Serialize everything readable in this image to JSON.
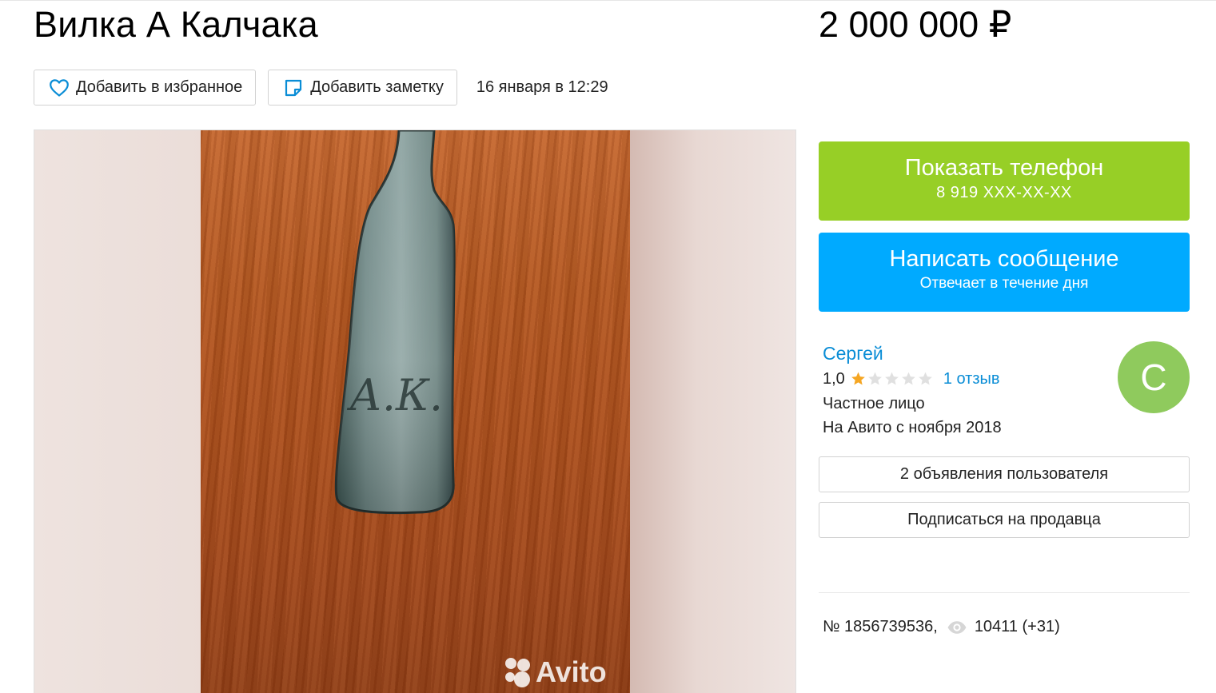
{
  "listing": {
    "title": "Вилка А Калчака",
    "price": "2 000 000 ₽",
    "date": "16 января в 12:29",
    "number": "№ 1856739536,",
    "views": "10411 (+31)"
  },
  "actions": {
    "favorite_label": "Добавить в избранное",
    "note_label": "Добавить заметку"
  },
  "contact": {
    "phone_button_label": "Показать телефон",
    "phone_masked": "8 919 XXX-XX-XX",
    "message_button_label": "Написать сообщение",
    "message_subtitle": "Отвечает в течение дня"
  },
  "seller": {
    "name": "Сергей",
    "rating": "1,0",
    "rating_value": 1,
    "rating_max": 5,
    "reviews": "1 отзыв",
    "type": "Частное лицо",
    "since": "На Авито с ноября 2018",
    "avatar_letter": "С",
    "listings_button": "2 объявления пользователя",
    "subscribe_button": "Подписаться на продавца"
  },
  "gallery": {
    "engraving": "А.К.",
    "watermark": "Avito"
  },
  "colors": {
    "phone_button": "#97cf26",
    "message_button": "#00aaff",
    "link": "#0a8dd6",
    "avatar": "#8fca5d",
    "star_filled": "#f5a623",
    "star_empty": "#e0e0e0"
  },
  "icons": {
    "favorite": "heart-outline-icon",
    "note": "sticky-note-icon",
    "views": "eye-icon"
  }
}
